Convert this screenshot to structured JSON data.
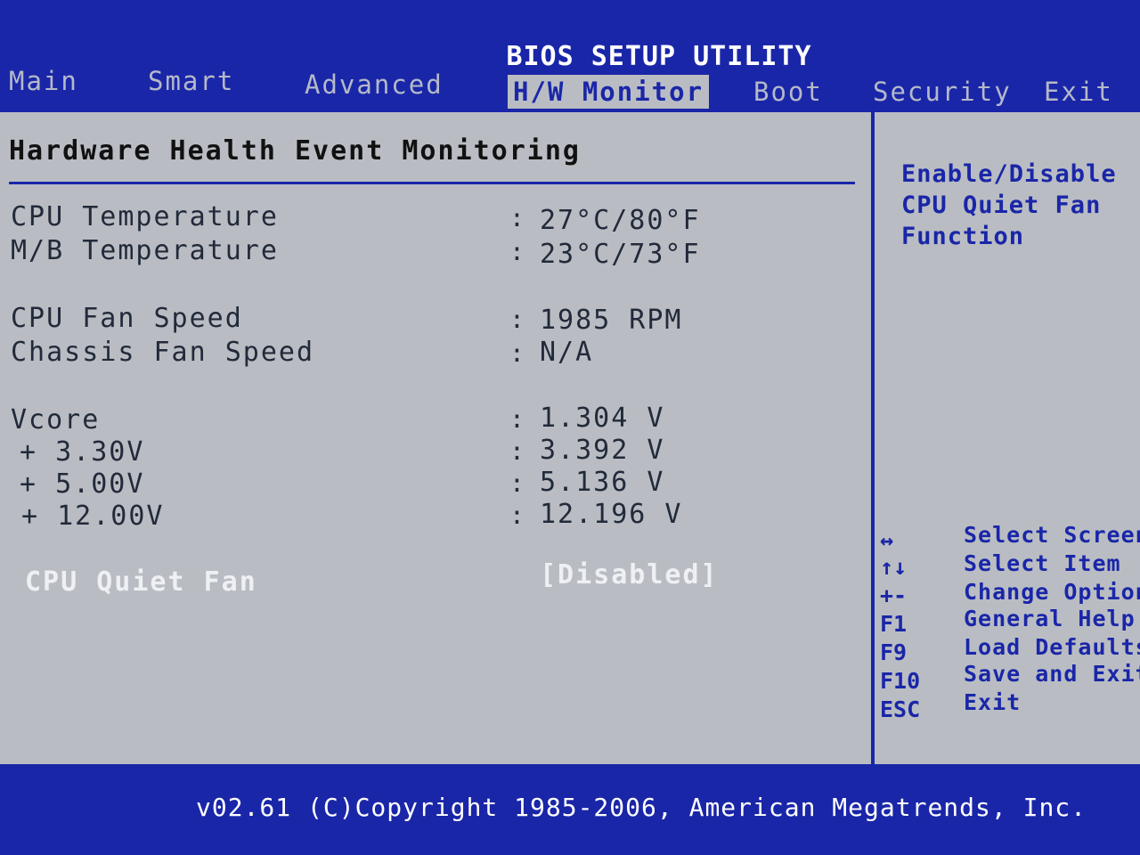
{
  "window": {
    "title": "BIOS SETUP UTILITY"
  },
  "tabs": [
    {
      "label": "Main"
    },
    {
      "label": "Smart"
    },
    {
      "label": "Advanced"
    },
    {
      "label": "H/W Monitor"
    },
    {
      "label": "Boot"
    },
    {
      "label": "Security"
    },
    {
      "label": "Exit"
    }
  ],
  "active_tab": "H/W Monitor",
  "section": {
    "title": "Hardware Health Event Monitoring"
  },
  "rows": [
    {
      "label": "CPU Temperature",
      "value": "27°C/80°F"
    },
    {
      "label": "M/B Temperature",
      "value": "23°C/73°F"
    },
    {
      "label": "CPU Fan Speed",
      "value": "1985 RPM"
    },
    {
      "label": "Chassis Fan Speed",
      "value": "N/A"
    },
    {
      "label": "Vcore",
      "value": "1.304 V"
    },
    {
      "label": "+ 3.30V",
      "value": "3.392 V"
    },
    {
      "label": "+ 5.00V",
      "value": "5.136 V"
    },
    {
      "label": "+ 12.00V",
      "value": "12.196 V"
    }
  ],
  "colon": ":",
  "option": {
    "label": "CPU Quiet Fan",
    "value": "[Disabled]"
  },
  "help": {
    "description": "Enable/Disable CPU Quiet Fan Function",
    "keys": [
      {
        "key": "↔",
        "desc": "Select Screen"
      },
      {
        "key": "↑↓",
        "desc": "Select Item"
      },
      {
        "key": "+-",
        "desc": "Change Option"
      },
      {
        "key": "F1",
        "desc": "General Help"
      },
      {
        "key": "F9",
        "desc": "Load Defaults"
      },
      {
        "key": "F10",
        "desc": "Save and Exit"
      },
      {
        "key": "ESC",
        "desc": "Exit"
      }
    ]
  },
  "footer": {
    "copyright": "v02.61 (C)Copyright 1985-2006, American Megatrends, Inc."
  },
  "colors": {
    "bios_blue": "#1a26a8",
    "background": "#b9bdc3",
    "highlight": "#eef0f4"
  }
}
